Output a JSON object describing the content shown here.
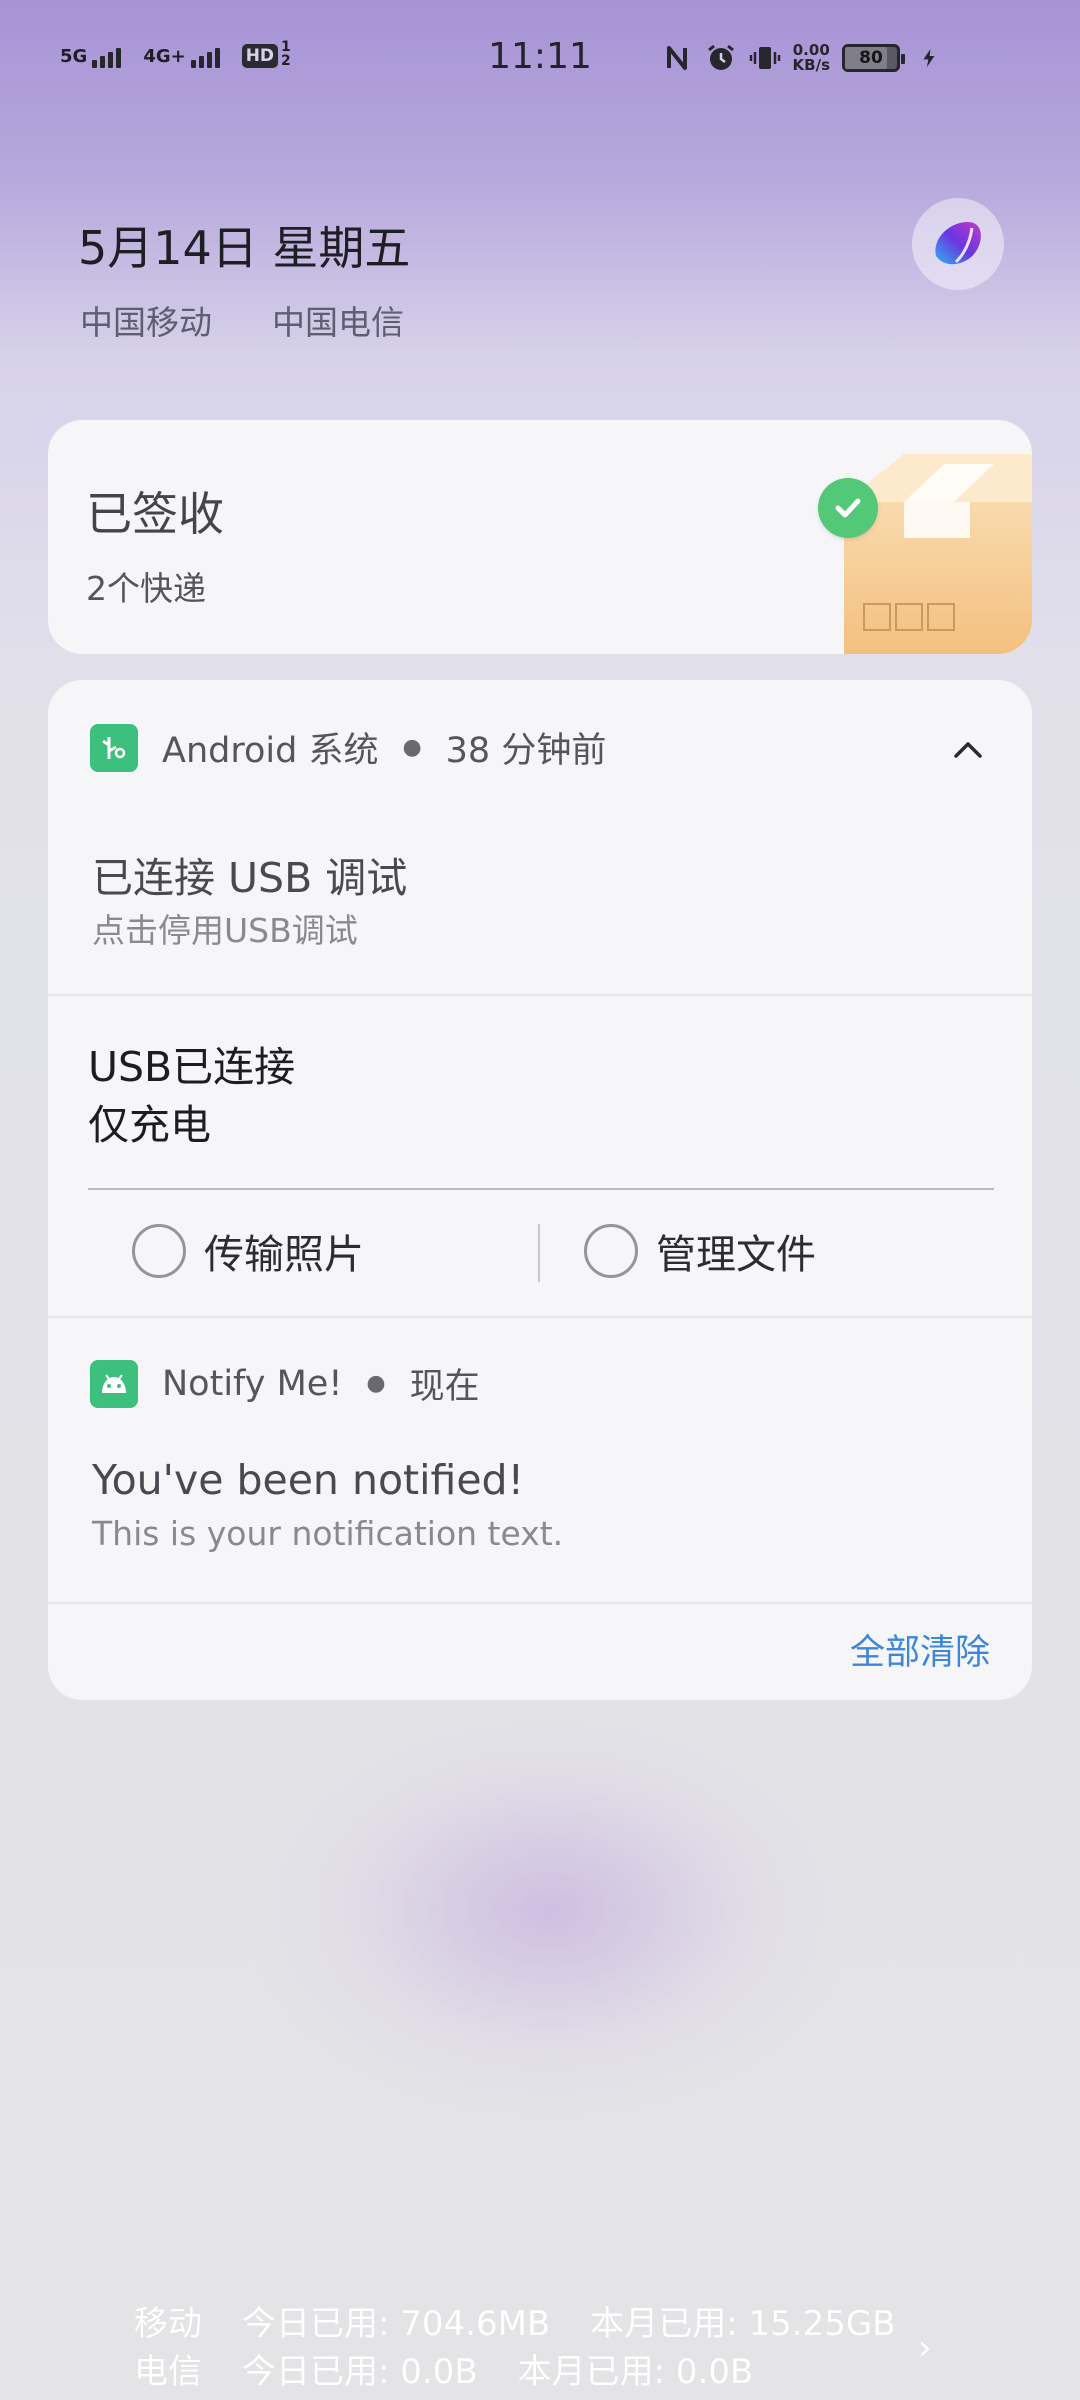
{
  "status_bar": {
    "net1": "5G",
    "net2": "4G+",
    "hd": "HD",
    "hd_sub": "1\n2",
    "time": "11:11",
    "speed_value": "0.00",
    "speed_unit": "KB/s",
    "battery": "80",
    "battery_level": 0.8,
    "icons": [
      "nfc-icon",
      "alarm-icon",
      "vibrate-icon",
      "charging-icon"
    ]
  },
  "header": {
    "date": "5月14日 星期五",
    "carrier1": "中国移动",
    "carrier2": "中国电信"
  },
  "card_delivery": {
    "title": "已签收",
    "subtitle": "2个快递"
  },
  "notification_android": {
    "app": "Android 系统",
    "time": "38 分钟前",
    "title": "已连接 USB 调试",
    "text": "点击停用USB调试"
  },
  "notification_usb": {
    "title": "USB已连接",
    "subtitle": "仅充电",
    "option1": "传输照片",
    "option2": "管理文件"
  },
  "notification_notifyme": {
    "app": "Notify Me!",
    "time": "现在",
    "title": "You've been notified!",
    "text": "This is your notification text."
  },
  "actions": {
    "clear_all": "全部清除"
  },
  "data_usage": {
    "row1_carrier": "移动",
    "row1_today": "今日已用: 704.6MB",
    "row1_month": "本月已用: 15.25GB",
    "row2_carrier": "电信",
    "row2_today": "今日已用: 0.0B",
    "row2_month": "本月已用: 0.0B",
    "arrow": "›"
  },
  "colors": {
    "accent": "#3d86d8",
    "app_icon_green": "#3dbf7d"
  }
}
